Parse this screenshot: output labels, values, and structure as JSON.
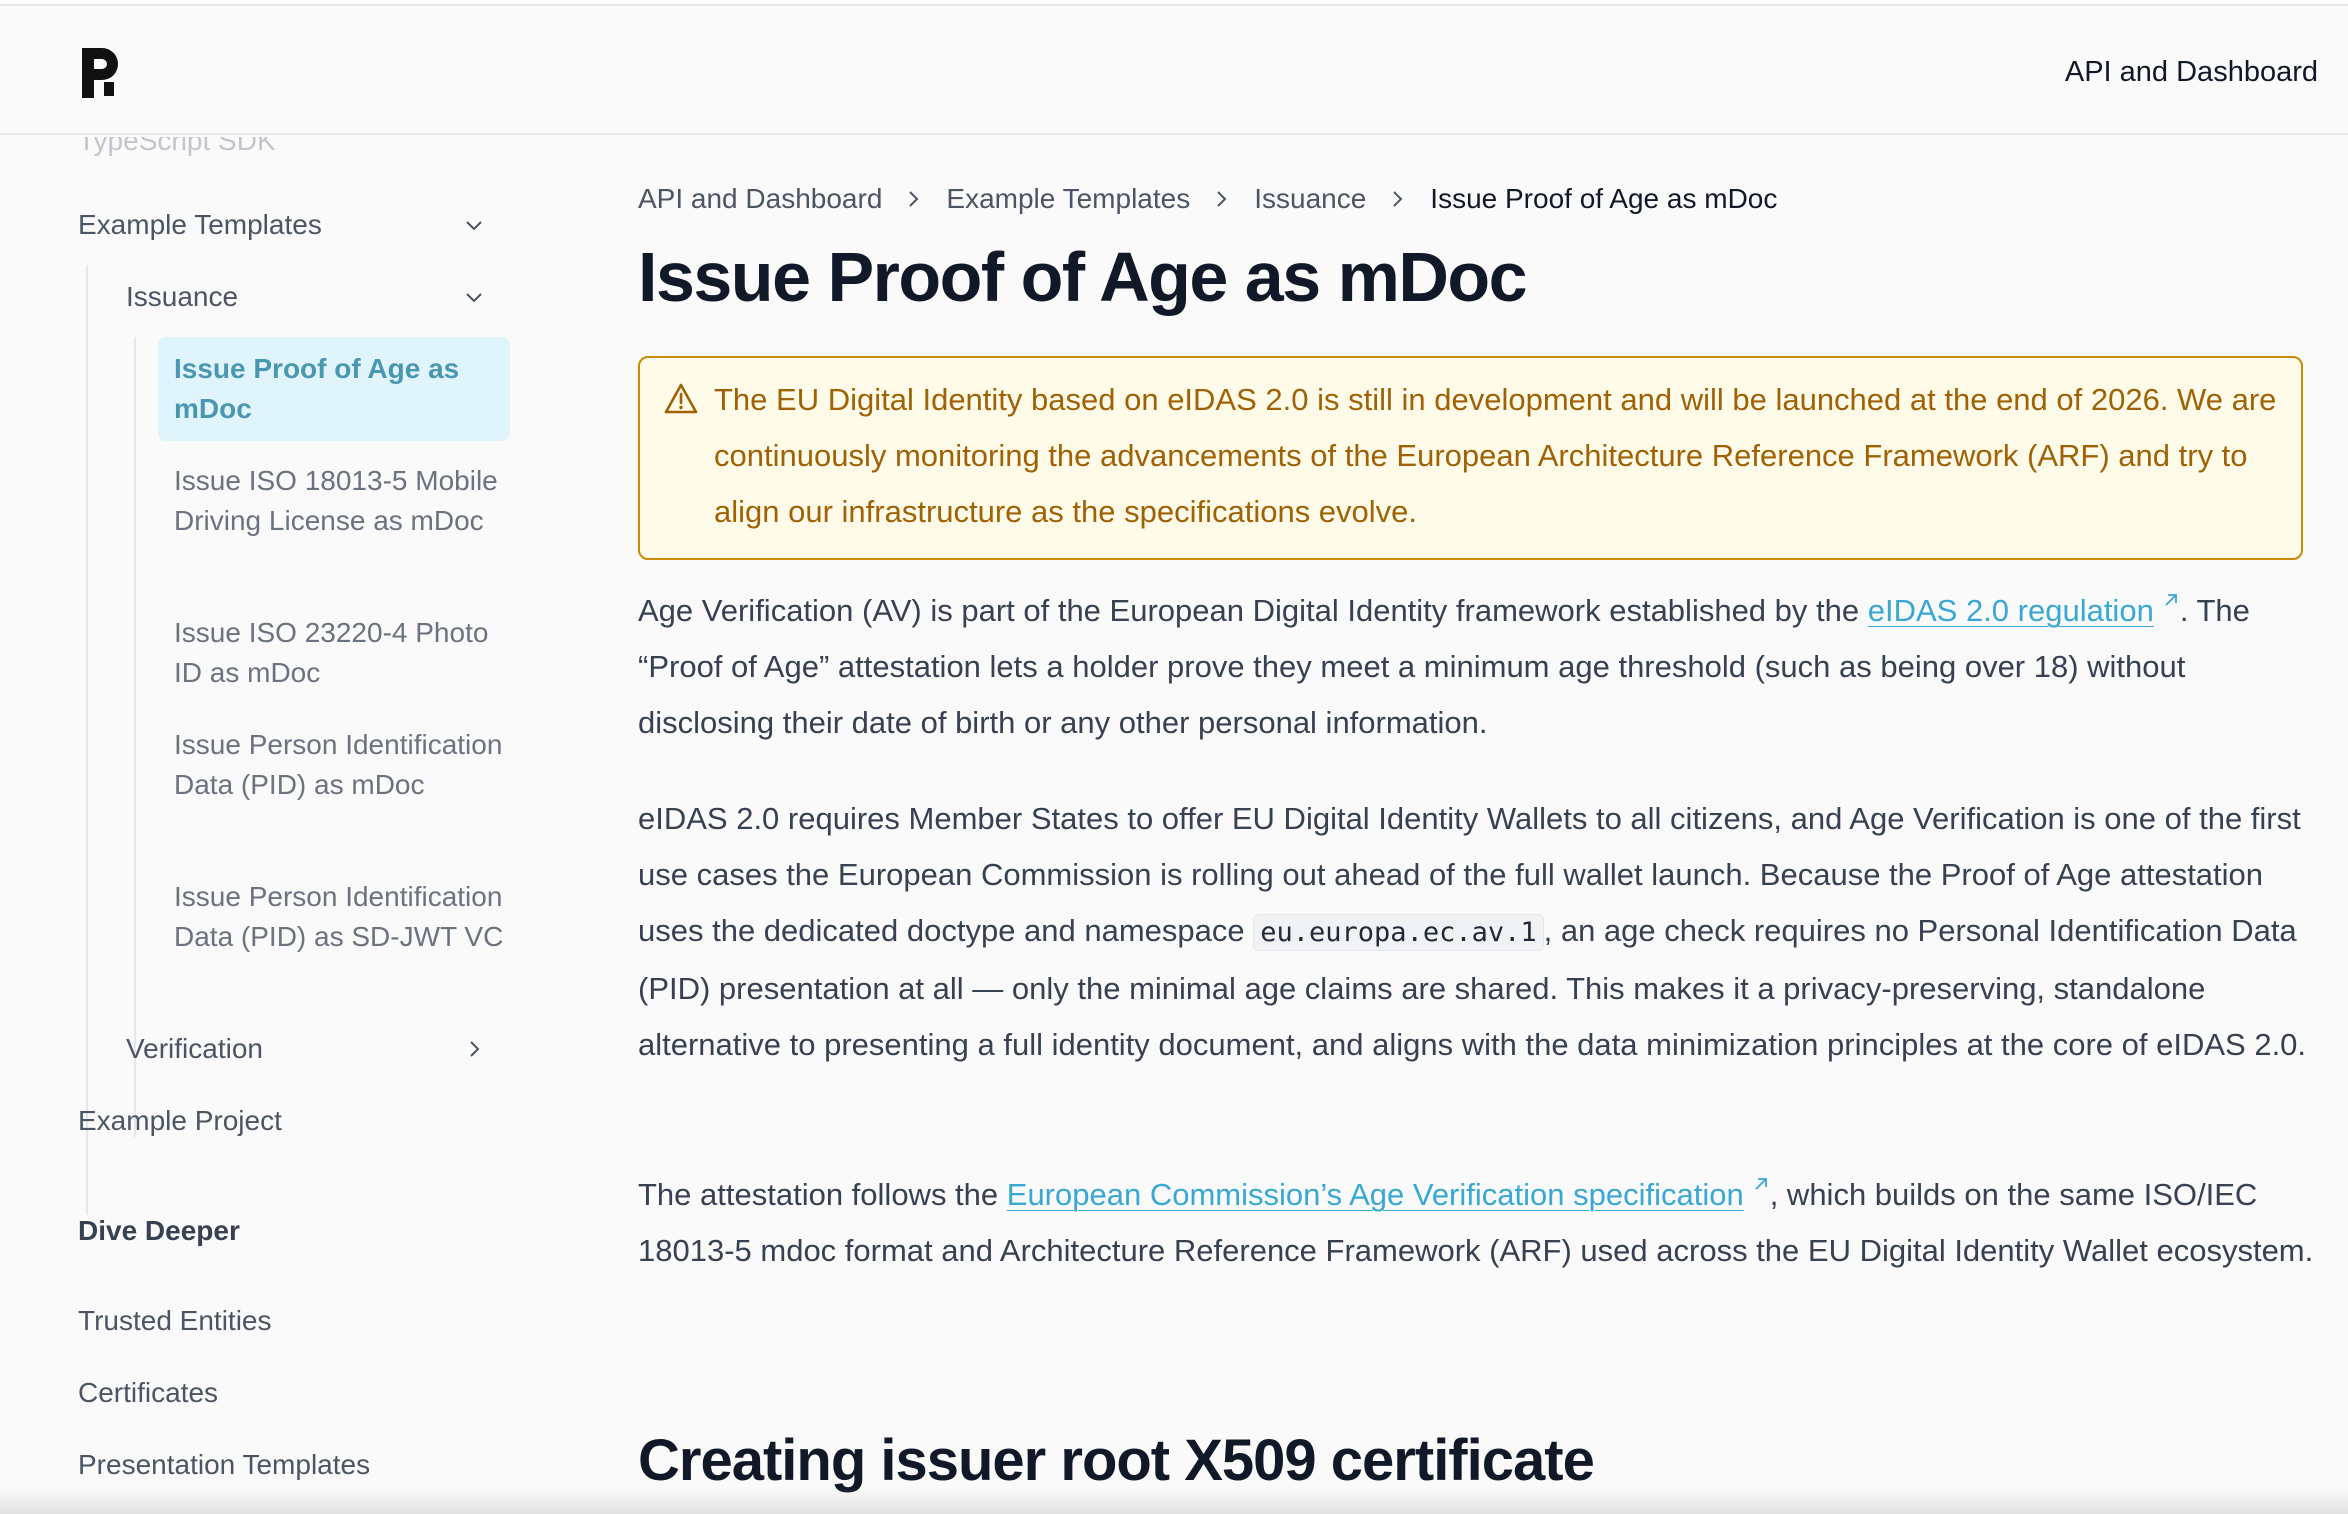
{
  "header": {
    "nav_link": "API and Dashboard"
  },
  "sidebar": {
    "faded_item": "TypeScript SDK",
    "example_templates": "Example Templates",
    "issuance": "Issuance",
    "active_item": "Issue Proof of Age as mDoc",
    "sub_items": [
      "Issue ISO 18013-5 Mobile Driving License as mDoc",
      "Issue ISO 23220-4 Photo ID as mDoc",
      "Issue Person Identification Data (PID) as mDoc",
      "Issue Person Identification Data (PID) as SD-JWT VC"
    ],
    "verification": "Verification",
    "example_project": "Example Project",
    "dive_deeper_heading": "Dive Deeper",
    "dive_items": [
      "Trusted Entities",
      "Certificates",
      "Presentation Templates"
    ]
  },
  "breadcrumb": [
    "API and Dashboard",
    "Example Templates",
    "Issuance",
    "Issue Proof of Age as mDoc"
  ],
  "page_title": "Issue Proof of Age as mDoc",
  "callout": {
    "icon": "warning-triangle-icon",
    "text": "The EU Digital Identity based on eIDAS 2.0 is still in development and will be launched at the end of 2026. We are continuously monitoring the advancements of the European Architecture Reference Framework (ARF) and try to align our infrastructure as the specifications evolve.",
    "color": "#a16207",
    "background": "#fefce8",
    "border": "#ca8a04"
  },
  "para1": {
    "before_link": "Age Verification (AV) is part of the European Digital Identity framework established by the ",
    "link": "eIDAS 2.0 regulation",
    "after_link": ". The “Proof of Age” attestation lets a holder prove they meet a minimum age threshold (such as being over 18) without disclosing their date of birth or any other personal information."
  },
  "para2": {
    "before_code": "eIDAS 2.0 requires Member States to offer EU Digital Identity Wallets to all citizens, and Age Verification is one of the first use cases the European Commission is rolling out ahead of the full wallet launch. Because the Proof of Age attestation uses the dedicated doctype and namespace ",
    "code": "eu.europa.ec.av.1",
    "after_code": ", an age check requires no Personal Identification Data (PID) presentation at all — only the minimal age claims are shared. This makes it a privacy-preserving, standalone alternative to presenting a full identity document, and aligns with the data minimization principles at the core of eIDAS 2.0."
  },
  "para3": {
    "before_link": "The attestation follows the ",
    "link": "European Commission’s Age Verification specification",
    "after_link": ", which builds on the same ISO/IEC 18013-5 mdoc format and Architecture Reference Framework (ARF) used across the EU Digital Identity Wallet ecosystem."
  },
  "section_heading": "Creating issuer root X509 certificate",
  "colors": {
    "accent": "#38a8d6",
    "active_bg": "#e0f4fb",
    "active_text": "#4a97b2"
  }
}
